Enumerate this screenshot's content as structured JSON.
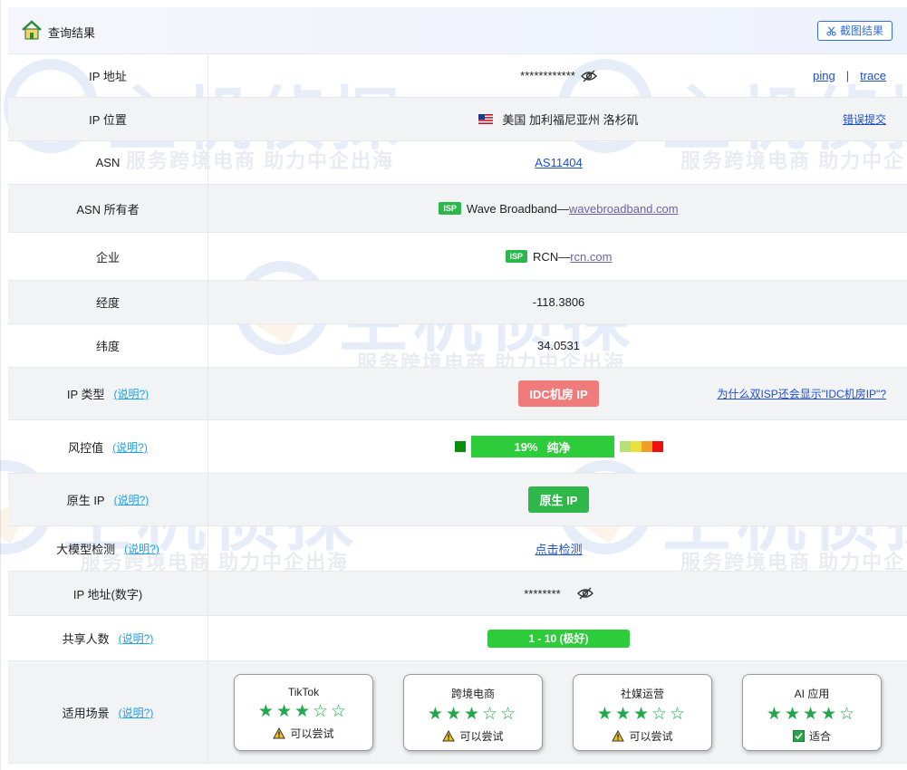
{
  "header": {
    "title": "查询结果",
    "screenshot_label": "截图结果"
  },
  "rows": {
    "ip": {
      "label": "IP 地址",
      "value": "************",
      "link_ping": "ping",
      "link_sep": "|",
      "link_trace": "trace"
    },
    "location": {
      "label": "IP 位置",
      "value": "美国 加利福尼亚州 洛杉矶",
      "link": "错误提交"
    },
    "asn": {
      "label": "ASN",
      "value": "AS11404"
    },
    "asn_owner": {
      "label": "ASN 所有者",
      "badge": "ISP",
      "name": "Wave Broadband—",
      "domain": "wavebroadband.com"
    },
    "org": {
      "label": "企业",
      "badge": "ISP",
      "name": "RCN—",
      "domain": "rcn.com"
    },
    "lon": {
      "label": "经度",
      "value": "-118.3806"
    },
    "lat": {
      "label": "纬度",
      "value": "34.0531"
    },
    "ip_type": {
      "label": "IP 类型",
      "explain": "(说明?)",
      "badge": "IDC机房 IP",
      "link": "为什么双ISP还会显示\"IDC机房IP\"?"
    },
    "risk": {
      "label": "风控值",
      "explain": "(说明?)",
      "percent": "19%",
      "text": "纯净",
      "score": 19
    },
    "native": {
      "label": "原生 IP",
      "explain": "(说明?)",
      "badge": "原生 IP"
    },
    "llm": {
      "label": "大模型检测",
      "explain": "(说明?)",
      "link": "点击检测"
    },
    "ip_num": {
      "label": "IP 地址(数字)",
      "value": "********"
    },
    "share": {
      "label": "共享人数",
      "explain": "(说明?)",
      "value": "1 - 10 (极好)"
    },
    "scene": {
      "label": "适用场景",
      "explain": "(说明?)"
    }
  },
  "scenes": [
    {
      "name": "TikTok",
      "stars": "★★★☆☆",
      "rating": 3,
      "status": "可以尝试",
      "status_icon": "warning-icon"
    },
    {
      "name": "跨境电商",
      "stars": "★★★☆☆",
      "rating": 3,
      "status": "可以尝试",
      "status_icon": "warning-icon"
    },
    {
      "name": "社媒运营",
      "stars": "★★★☆☆",
      "rating": 3,
      "status": "可以尝试",
      "status_icon": "warning-icon"
    },
    {
      "name": "AI 应用",
      "stars": "★★★★☆",
      "rating": 4,
      "status": "适合",
      "status_icon": "check-icon"
    }
  ],
  "watermark": {
    "brand": "主机侦探",
    "slogan": "服务跨境电商 助力中企出海"
  },
  "colors": {
    "link": "#1f4fd1",
    "explain": "#1e9fe8",
    "green": "#2ccc3a",
    "idc_red": "#f07b7b",
    "star": "#20a84a"
  }
}
